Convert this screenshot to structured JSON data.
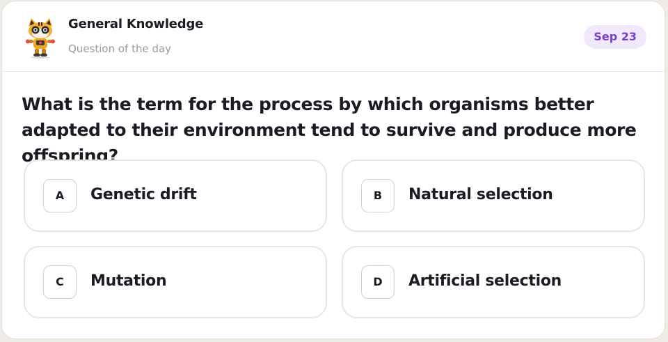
{
  "header": {
    "title": "General Knowledge",
    "subtitle": "Question of the day",
    "date": "Sep 23",
    "avatar_icon": "robot-cat-mascot-icon"
  },
  "question": {
    "text": "What is the term for the process by which organisms better adapted to their environment tend to survive and produce more offspring?"
  },
  "options": [
    {
      "letter": "A",
      "label": "Genetic drift"
    },
    {
      "letter": "B",
      "label": "Natural selection"
    },
    {
      "letter": "C",
      "label": "Mutation"
    },
    {
      "letter": "D",
      "label": "Artificial selection"
    }
  ],
  "colors": {
    "badge_bg": "#f1e9fb",
    "badge_text": "#7a3fce",
    "text_primary": "#1c1a24",
    "text_muted": "#9a9a9f"
  }
}
